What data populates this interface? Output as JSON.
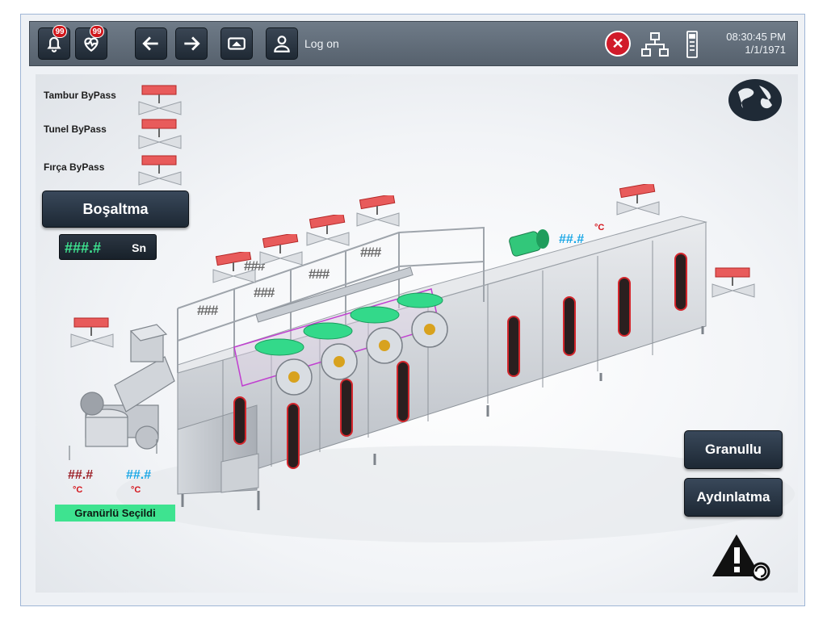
{
  "topbar": {
    "alarm_count": "99",
    "diag_count": "99",
    "logon_label": "Log on",
    "time": "08:30:45 PM",
    "date": "1/1/1971"
  },
  "bypass": [
    {
      "label": "Tambur ByPass"
    },
    {
      "label": "Tunel ByPass"
    },
    {
      "label": "Fırça ByPass"
    }
  ],
  "controls": {
    "bosaltma_label": "Boşaltma",
    "timer_value": "###.#",
    "timer_unit": "Sn",
    "granullu_label": "Granullu",
    "aydinlatma_label": "Aydınlatma"
  },
  "machine": {
    "hash_values": [
      "###",
      "###",
      "###",
      "###",
      "###"
    ],
    "tunnel_temp": "##.#",
    "tunnel_temp_unit": "°C",
    "mixer_temp_1": "##.#",
    "mixer_temp_1_unit": "°C",
    "mixer_temp_2": "##.#",
    "mixer_temp_2_unit": "°C",
    "selected_label": "Granürlü Seçildi"
  },
  "icons": {
    "alarm": "bell-icon",
    "diagnostics": "heartbeat-icon",
    "back": "arrow-left-icon",
    "forward": "arrow-right-icon",
    "screen": "screen-eject-icon",
    "user": "user-icon",
    "error": "error-x-icon",
    "network": "network-icon",
    "device": "device-icon",
    "language": "globe-icon",
    "warning": "warning-icon"
  },
  "colors": {
    "accent_green": "#3ee390",
    "alarm_red": "#d0161b",
    "temp_blue": "#1aa7e6",
    "temp_red": "#9b1d24",
    "button_dark": "#1d2834"
  }
}
